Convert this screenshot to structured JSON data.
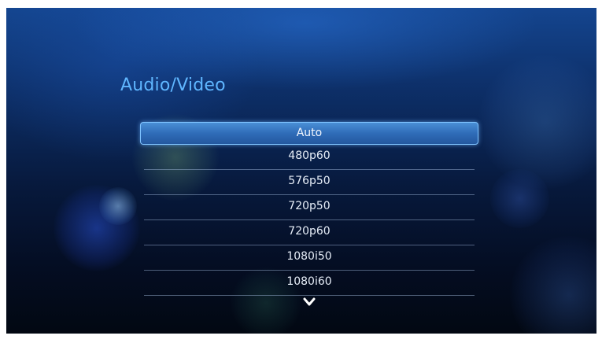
{
  "screen": {
    "title": "Audio/Video"
  },
  "menu": {
    "items": [
      {
        "label": "Auto",
        "selected": true
      },
      {
        "label": "480p60",
        "selected": false
      },
      {
        "label": "576p50",
        "selected": false
      },
      {
        "label": "720p50",
        "selected": false
      },
      {
        "label": "720p60",
        "selected": false
      },
      {
        "label": "1080i50",
        "selected": false
      },
      {
        "label": "1080i60",
        "selected": false
      }
    ],
    "more_indicator_icon": "chevron-down-icon"
  },
  "colors": {
    "title": "#5fb6ff",
    "selection": "#2f6cb8",
    "item_text": "#e6edf7"
  }
}
